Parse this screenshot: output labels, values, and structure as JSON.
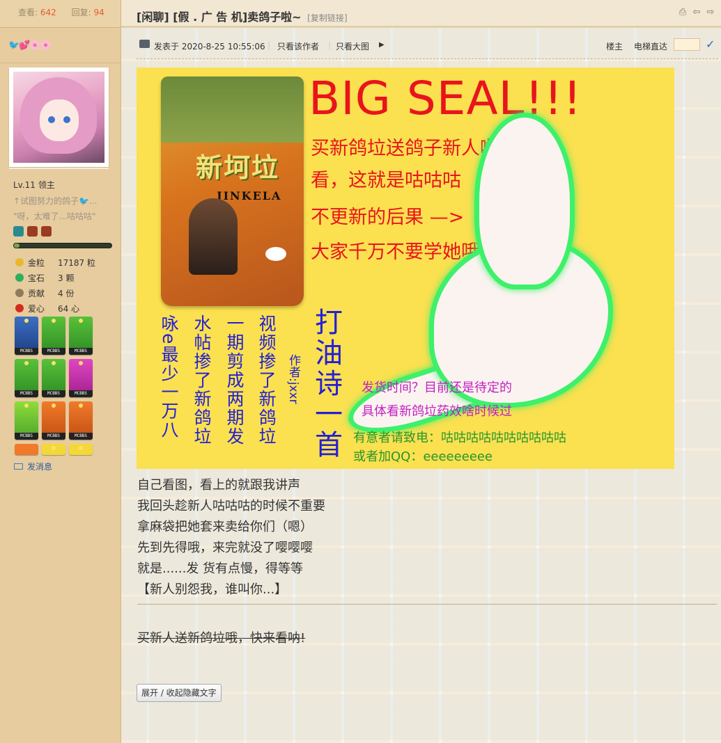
{
  "sidebar": {
    "stats": {
      "views_label": "查看:",
      "views": "642",
      "replies_label": "回复:",
      "replies": "94"
    },
    "emoji_row": "🐦💕🌸🌸",
    "level": "Lv.11 领主",
    "motto_line1": "↑试图努力的鸽子🐦...",
    "motto_line2": "\"呀，太难了...咕咕咕\"",
    "props": [
      {
        "icon": "gold-coin-icon",
        "name": "金粒",
        "value": "17187 粒",
        "color": "#e8b82c"
      },
      {
        "icon": "gem-icon",
        "name": "宝石",
        "value": "3 颗",
        "color": "#2fae5f"
      },
      {
        "icon": "contribution-icon",
        "name": "贡献",
        "value": "4 份",
        "color": "#8f7b5c"
      },
      {
        "icon": "heart-apple-icon",
        "name": "爱心",
        "value": "64 心",
        "color": "#d52b1e"
      }
    ],
    "medal_label": "MCBBS",
    "send_message": "发消息"
  },
  "title": {
    "text": "[闲聊] [假 . 广 告 机]卖鸽子啦~",
    "copy_link": "[复制链接]"
  },
  "meta": {
    "posted": "发表于 2020-8-25 10:55:06",
    "only_author": "只看该作者",
    "large_image": "只看大图",
    "floor_owner": "楼主",
    "elevator": "电梯直达"
  },
  "poster": {
    "package_name": "新坷垃",
    "package_brand": "JINKELA",
    "headline": "BIG SEAL!!!",
    "red_lines": [
      "买新鸽垃送鸽子新人啦!",
      "看，这就是咕咕咕",
      "不更新的后果 —>",
      "大家千万不要学她哦!"
    ],
    "poem_title": "打油诗一首",
    "author": "作者:jxxr",
    "poem_cols": [
      "视频掺了新鸽垃",
      "一期剪成两期发",
      "水帖掺了新鸽垃",
      "咏e最少一万八"
    ],
    "magenta_lines": [
      "发货时间？目前还是待定的",
      "具体看新鸽垃药效啥时候过"
    ],
    "green_lines": [
      "有意者请致电：咕咕咕咕咕咕咕咕咕咕",
      "或者加QQ：eeeeeeeee"
    ]
  },
  "post_lines": [
    "自己看图，看上的就跟我讲声",
    "我回头趁新人咕咕咕的时候不重要",
    "拿麻袋把她套来卖给你们（嗯）",
    "先到先得哦，来完就没了嘤嘤嘤",
    "就是......发 货有点慢，得等等",
    "【新人别怨我，谁叫你...】"
  ],
  "strike_text": "买新人送新鸽垃哦，快来看呐!",
  "toggle_button": "展开 / 收起隐藏文字",
  "colors": {
    "sidebar_bg": "#e7cc9f",
    "accent_red": "#e8141c",
    "poster_bg": "#fbe050",
    "link_blue": "#2a5a9b"
  }
}
